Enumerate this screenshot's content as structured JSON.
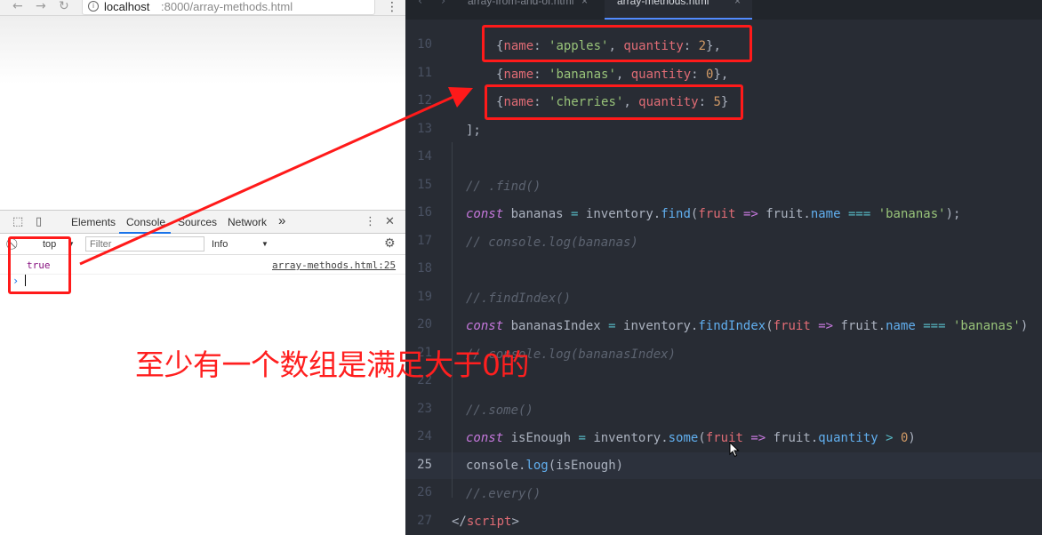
{
  "browser": {
    "nav": {
      "back": "←",
      "forward": "→",
      "reload": "↻"
    },
    "url_host": "localhost",
    "url_rest": ":8000/array-methods.html",
    "menu": "⋮"
  },
  "devtools": {
    "tabs": [
      "Elements",
      "Console",
      "Sources",
      "Network"
    ],
    "more_tabs": "»",
    "menu": "⋮",
    "close": "✕",
    "context": "top",
    "filter_placeholder": "Filter",
    "level": "Info",
    "log": {
      "value": "true",
      "source": "array-methods.html:25"
    },
    "prompt": "›"
  },
  "editor": {
    "tabs": [
      "array-from-and-of.html",
      "array-methods.html"
    ],
    "tab_close": "×",
    "nav_prev": "‹",
    "nav_next": "›",
    "line_numbers": [
      "10",
      "11",
      "12",
      "13",
      "14",
      "15",
      "16",
      "17",
      "18",
      "19",
      "20",
      "21",
      "22",
      "23",
      "24",
      "25",
      "26",
      "27"
    ],
    "current_line": "25",
    "comments": {
      "find": "// .find()",
      "log_bananas": "// console.log(bananas)",
      "findIndex": "//.findIndex()",
      "log_bananas_index": "// console.log(bananasIndex)",
      "some": "//.some()",
      "every": "//.every()"
    },
    "strings": {
      "apples": "'apples'",
      "bananas": "'bananas'",
      "cherries": "'cherries'"
    },
    "numbers": {
      "two": "2",
      "zero": "0",
      "five": "5"
    },
    "identifiers": {
      "const": "const",
      "bananas": "bananas",
      "bananasIndex": "bananasIndex",
      "isEnough": "isEnough",
      "inventory": "inventory",
      "find": "find",
      "findIndex": "findIndex",
      "some": "some",
      "fruit": "fruit",
      "name": "name",
      "quantity": "quantity",
      "console": "console",
      "log": "log",
      "script": "script"
    }
  },
  "annotation": {
    "caption": "至少有一个数组是满足大于0的"
  },
  "colors": {
    "annotation_red": "#ff1a1a",
    "editor_bg": "#282c34"
  }
}
